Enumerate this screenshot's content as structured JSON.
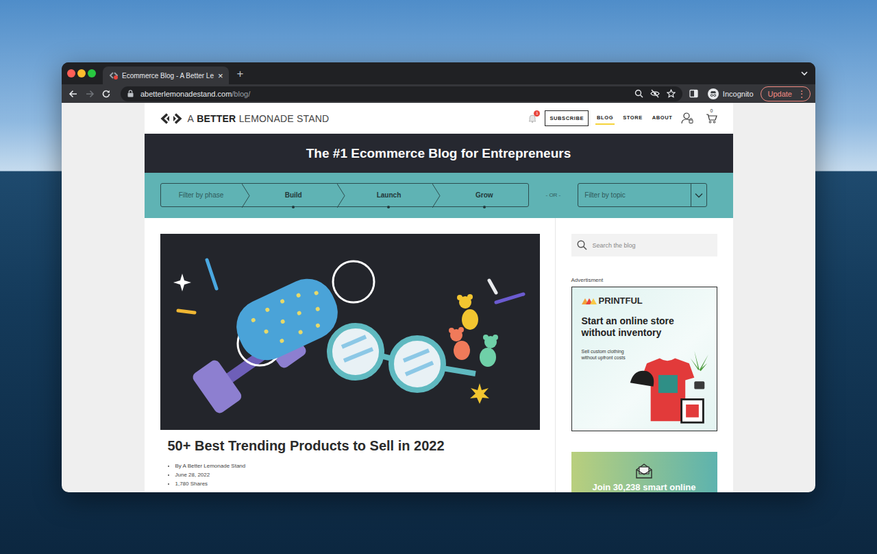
{
  "browser": {
    "tabs": [
      {
        "label": "Ecommerce Blog - A Better Le",
        "selected": true,
        "close": "×"
      }
    ],
    "new_tab": "+",
    "back": {
      "disabled": false
    },
    "forward": {
      "disabled": true
    },
    "address": {
      "host": "abetterlemonadestand.com",
      "path": "/blog/"
    },
    "profile": "Incognito",
    "update_button": {
      "label": "Update",
      "menu": "⋮"
    }
  },
  "site": {
    "logo": [
      {
        "text": "A",
        "bold": false
      },
      {
        "text": "BETTER",
        "bold": true
      },
      {
        "text": "LEMONADE STAND",
        "bold": false
      }
    ],
    "notifications": "1",
    "nav": [
      {
        "label": "SUBSCRIBE",
        "kind": "button",
        "selected": false
      },
      {
        "label": "BLOG",
        "kind": "link",
        "selected": true
      },
      {
        "label": "STORE",
        "kind": "link",
        "selected": false
      },
      {
        "label": "ABOUT",
        "kind": "link",
        "selected": false
      }
    ],
    "cart_count": "0",
    "headline": "The #1 Ecommerce Blog for Entrepreneurs",
    "phase_filter": {
      "label": "Filter by phase",
      "phases": [
        "Build",
        "Launch",
        "Grow"
      ]
    },
    "separator": "- OR -",
    "topic_filter": {
      "placeholder": "Filter by topic"
    },
    "post": {
      "title": "50+ Best Trending Products to Sell in 2022",
      "meta": [
        "By A Better Lemonade Stand",
        "June 28, 2022",
        "1,780 Shares"
      ]
    },
    "sidebar": {
      "search_placeholder": "Search the blog",
      "ad_label": "Advertisment",
      "ad": {
        "brand": "PRINTFUL",
        "headline": "Start an online store without inventory",
        "subline": "Sell custom clothing without upfront costs"
      },
      "newsletter": {
        "title": "Join 30,238 smart online"
      }
    }
  }
}
